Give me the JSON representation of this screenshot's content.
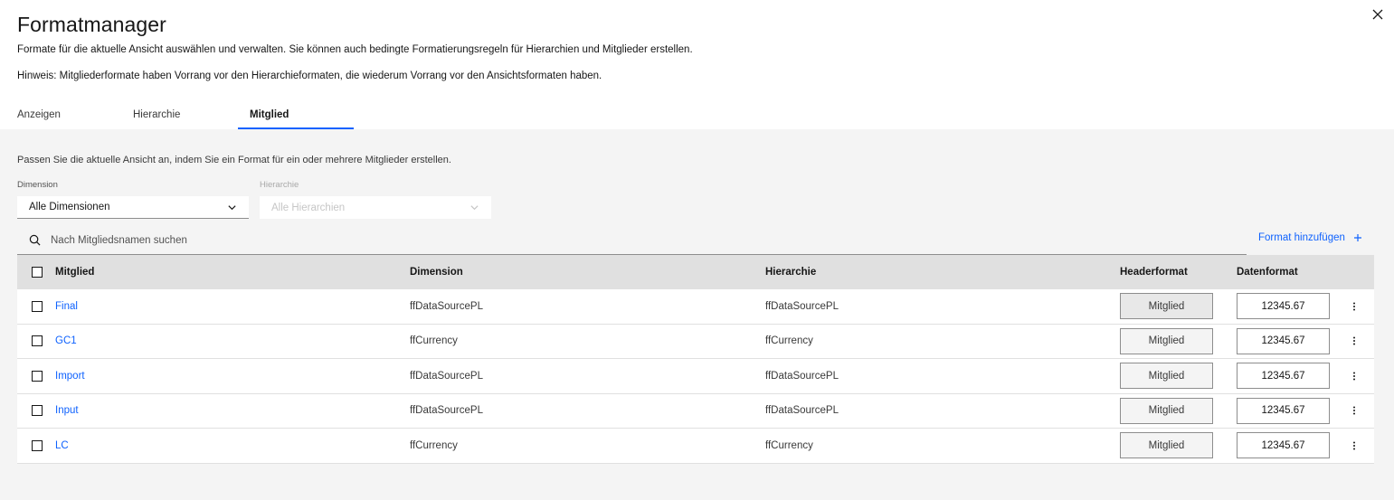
{
  "title": "Formatmanager",
  "description": "Formate für die aktuelle Ansicht auswählen und verwalten. Sie können auch bedingte Formatierungsregeln für Hierarchien und Mitglieder erstellen.",
  "hint": "Hinweis: Mitgliederformate haben Vorrang vor den Hierarchieformaten, die wiederum Vorrang vor den Ansichtsformaten haben.",
  "close_icon": "close-icon",
  "tabs": [
    {
      "label": "Anzeigen"
    },
    {
      "label": "Hierarchie"
    },
    {
      "label": "Mitglied",
      "selected": true
    }
  ],
  "panel": {
    "intro": "Passen Sie die aktuelle Ansicht an, indem Sie ein Format für ein oder mehrere Mitglieder erstellen.",
    "dimension_label": "Dimension",
    "dimension_value": "Alle Dimensionen",
    "hierarchy_label": "Hierarchie",
    "hierarchy_value": "Alle Hierarchien",
    "search_placeholder": "Nach Mitgliedsnamen suchen",
    "add_format_label": "Format hinzufügen"
  },
  "table": {
    "headers": {
      "member": "Mitglied",
      "dimension": "Dimension",
      "hierarchy": "Hierarchie",
      "header_format": "Headerformat",
      "data_format": "Datenformat"
    },
    "rows": [
      {
        "member": "Final",
        "dimension": "ffDataSourcePL",
        "hierarchy": "ffDataSourcePL",
        "header_format": "Mitglied",
        "data_format": "12345.67"
      },
      {
        "member": "GC1",
        "dimension": "ffCurrency",
        "hierarchy": "ffCurrency",
        "header_format": "Mitglied",
        "data_format": "12345.67"
      },
      {
        "member": "Import",
        "dimension": "ffDataSourcePL",
        "hierarchy": "ffDataSourcePL",
        "header_format": "Mitglied",
        "data_format": "12345.67"
      },
      {
        "member": "Input",
        "dimension": "ffDataSourcePL",
        "hierarchy": "ffDataSourcePL",
        "header_format": "Mitglied",
        "data_format": "12345.67"
      },
      {
        "member": "LC",
        "dimension": "ffCurrency",
        "hierarchy": "ffCurrency",
        "header_format": "Mitglied",
        "data_format": "12345.67"
      }
    ]
  },
  "colors": {
    "accent": "#0f62fe",
    "panel_bg": "#f4f4f4",
    "header_bg": "#e0e0e0"
  }
}
